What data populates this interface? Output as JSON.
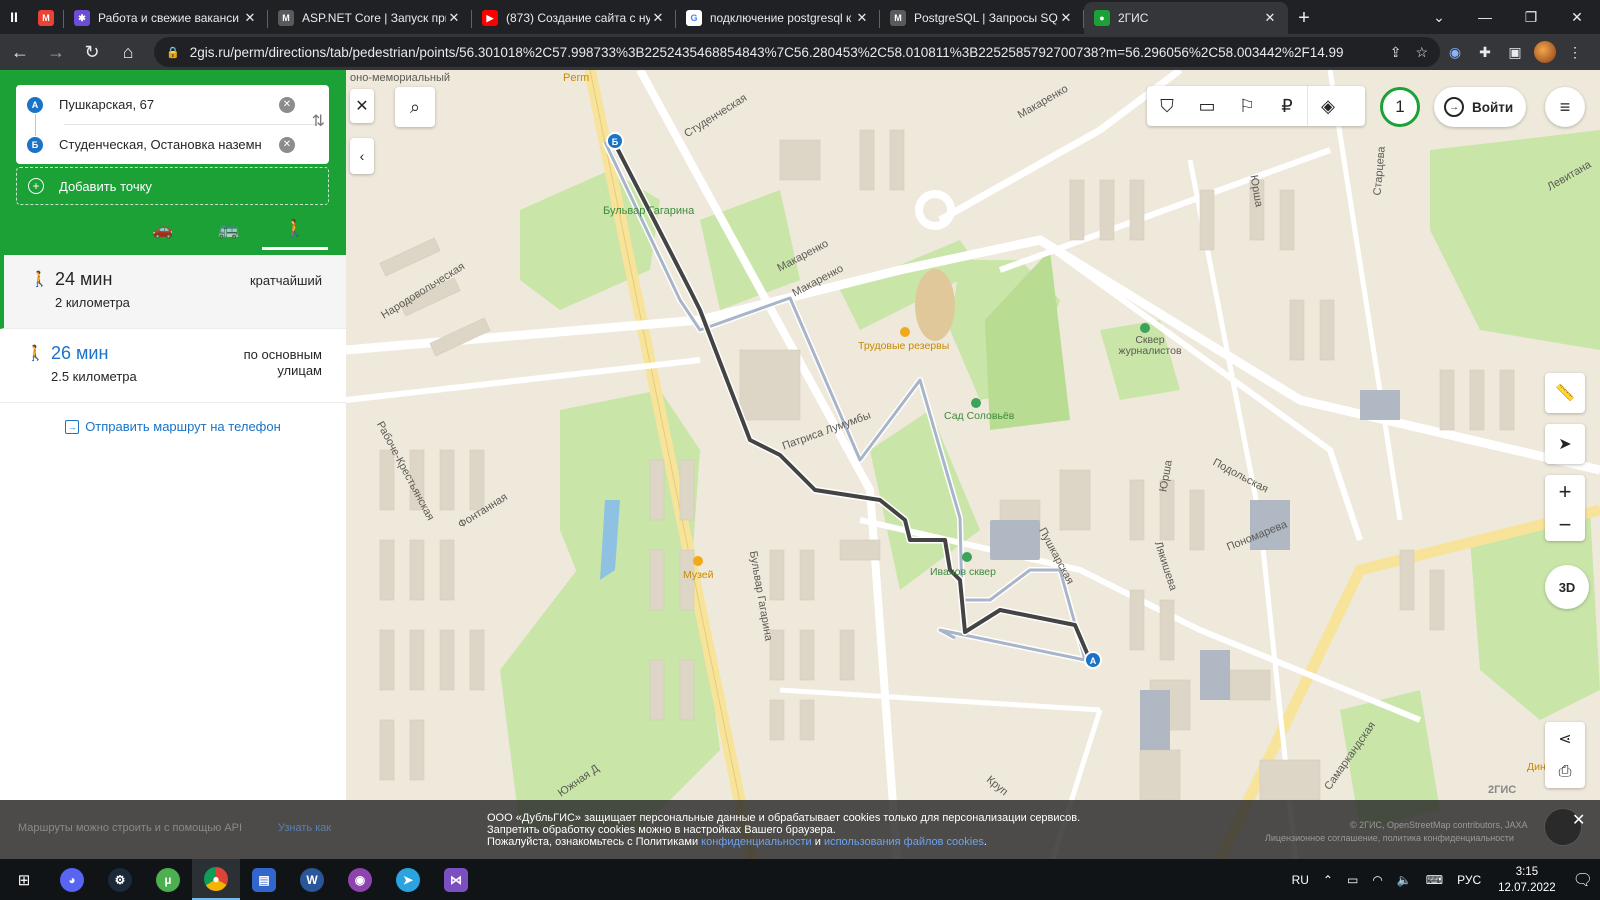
{
  "browser": {
    "tabs": [
      {
        "title": "",
        "favicon": "gmail-icon",
        "color": "#ea4335",
        "close": ""
      },
      {
        "title": "Работа и свежие ваканси",
        "favicon": "hh-icon",
        "color": "#6c4dd6",
        "close": "✕"
      },
      {
        "title": "ASP.NET Core | Запуск при",
        "favicon": "metanit-icon",
        "color": "#5a5a5a",
        "close": "✕"
      },
      {
        "title": "(873) Создание сайта с ну",
        "favicon": "youtube-icon",
        "color": "#ff0000",
        "close": "✕"
      },
      {
        "title": "подключение postgresql к",
        "favicon": "google-icon",
        "color": "#4285f4",
        "close": "✕"
      },
      {
        "title": "PostgreSQL | Запросы SQL",
        "favicon": "metanit-icon",
        "color": "#5a5a5a",
        "close": "✕"
      },
      {
        "title": "2ГИС",
        "favicon": "2gis-icon",
        "color": "#1ba136",
        "close": "✕"
      }
    ],
    "url": "2gis.ru/perm/directions/tab/pedestrian/points/56.301018%2C57.998733%3B2252435468854843%7C56.280453%2C58.010811%3B2252585792700738?m=56.296056%2C58.003442%2F14.99"
  },
  "route_panel": {
    "point_a": {
      "badge": "A",
      "text": "Пушкарская, 67"
    },
    "point_b": {
      "badge": "Б",
      "text": "Студенческая, Остановка наземн"
    },
    "add_point": "Добавить точку",
    "routes": [
      {
        "time": "24 мин",
        "distance": "2 километра",
        "tag": "кратчайший"
      },
      {
        "time": "26 мин",
        "distance": "2.5 километра",
        "tag": "по основным улицам"
      }
    ],
    "send_to_phone": "Отправить маршрут на телефон"
  },
  "map": {
    "labels": {
      "perm": "Perm",
      "memorial": "оно-мемориальный",
      "studencheskaya": "Студенческая",
      "bulvar_gagarina_stop": "Бульвар Гагарина",
      "makarenko1": "Макаренко",
      "makarenko2": "Макаренко",
      "makarenko3": "Макаренко",
      "narodovolcheskaya": "Народовольческая",
      "trudovye": "Трудовые резервы",
      "skver_journ": "Сквер журналистов",
      "sad_soloviev": "Сад Соловьёв",
      "patrisa": "Патриса Лумумбы",
      "raboche": "Рабоче-Крестьянская",
      "fontannaya": "Фонтанная",
      "muzey": "Музей",
      "bulvar_gagarina": "Бульвар Гагарина",
      "ivanov_skver": "Иванов сквер",
      "pushkarskaya": "Пушкарская",
      "yursha1": "Юрша",
      "yursha2": "Юрша",
      "podolskaya": "Подольская",
      "lyakisheva": "Лякишева",
      "ponomareva": "Пономарева",
      "starceva": "Старцева",
      "levitana": "Левитана",
      "samarkandskaya": "Самаркандская",
      "yuzhnaya": "Южная Д",
      "krupskoy": "Круп",
      "din": "Дин"
    },
    "notif_count": "1",
    "login": "Войти",
    "btn_3d": "3D",
    "brand": "2ГИС"
  },
  "cookie": {
    "left_text": "Маршруты можно строить и с помощью API",
    "left_link": "Узнать как",
    "line1": "ООО «ДубльГИС» защищает персональные данные и обрабатывает cookies только для персонализации сервисов.",
    "line2": "Запретить обработку cookies можно в настройках Вашего браузера.",
    "line3_prefix": "Пожалуйста, ознакомьтесь с Политиками ",
    "link1": "конфиденциальности",
    "and": " и ",
    "link2": "использования файлов cookies",
    "dot": ".",
    "right1": "© 2ГИС, OpenStreetMap contributors, JAXA",
    "right2": "Лицензионное соглашение, политика конфиденциальности"
  },
  "taskbar": {
    "lang": "RU",
    "kbd": "РУС",
    "time": "3:15",
    "date": "12.07.2022"
  }
}
